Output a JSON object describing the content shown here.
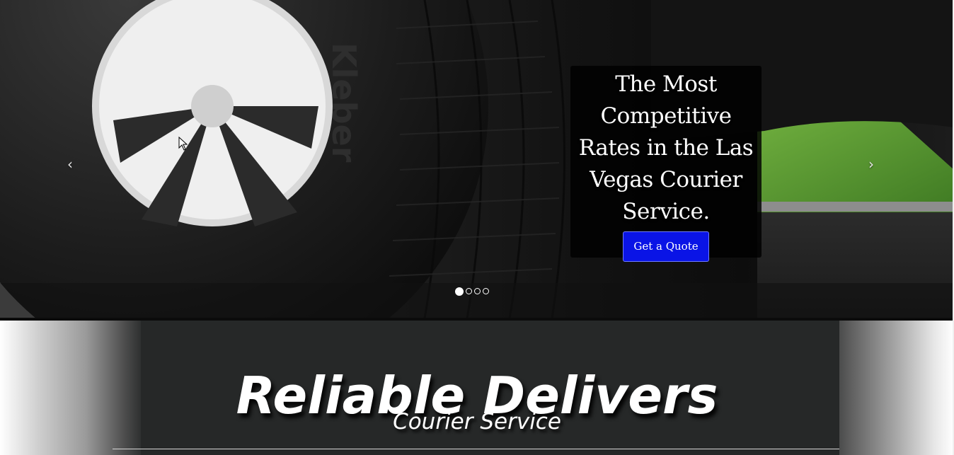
{
  "carousel": {
    "prev_icon": "chevron-left-icon",
    "prev_glyph": "‹",
    "next_icon": "chevron-right-icon",
    "next_glyph": "›",
    "caption": "The Most Competitive Rates in the Las Vegas Courier Service.",
    "button_label": "Get a Quote",
    "slide_count": 4,
    "active_slide": 1,
    "colors": {
      "button": "#0a14e6",
      "caption_bg": "#000000"
    }
  },
  "banner": {
    "title": "Reliable Delivers",
    "subtitle": "Courier Service",
    "colors": {
      "panel": "#262828",
      "text": "#ffffff"
    }
  }
}
